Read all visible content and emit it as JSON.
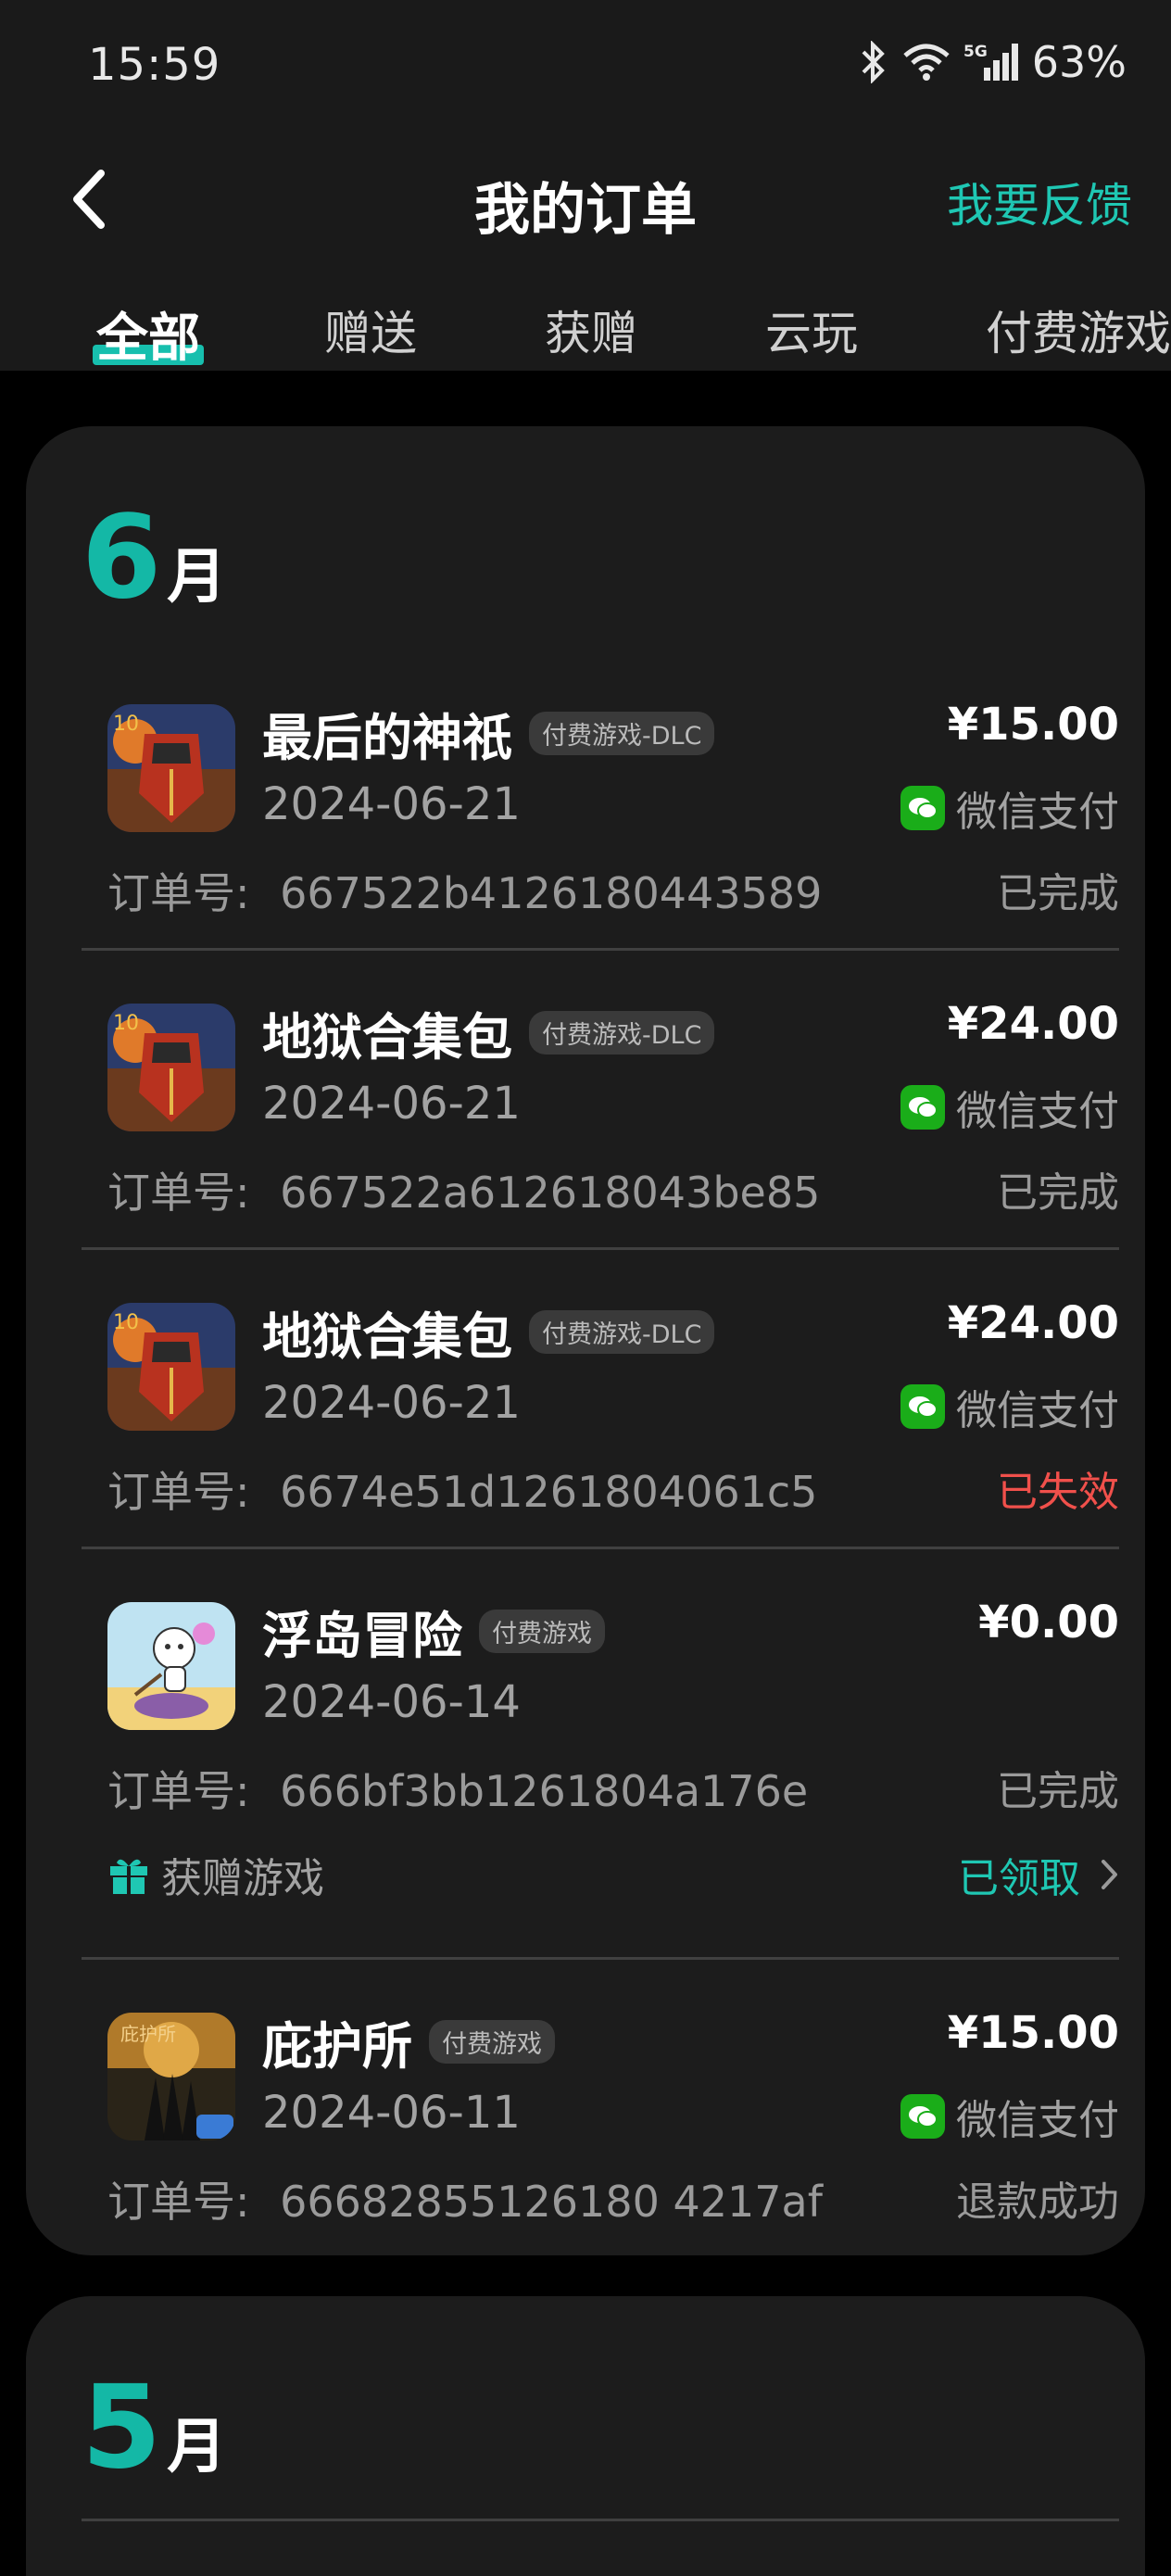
{
  "status_bar": {
    "time": "15:59",
    "network": "5G",
    "battery": "63%",
    "icons": [
      "bluetooth-icon",
      "wifi-icon",
      "cellular-signal-icon"
    ]
  },
  "header": {
    "title": "我的订单",
    "feedback": "我要反馈",
    "back_icon": "chevron-left-icon"
  },
  "tabs": [
    {
      "label": "全部",
      "active": true
    },
    {
      "label": "赠送",
      "active": false
    },
    {
      "label": "获赠",
      "active": false
    },
    {
      "label": "云玩",
      "active": false
    },
    {
      "label": "付费游戏",
      "active": false
    }
  ],
  "colors": {
    "accent": "#14b8a6",
    "failed": "#f0504b",
    "wechat": "#1aad19"
  },
  "months": [
    {
      "month_num": "6",
      "month_unit": "月",
      "orders": [
        {
          "name": "最后的神祇",
          "tag": "付费游戏-DLC",
          "date": "2024-06-21",
          "price": "¥15.00",
          "payment": "微信支付",
          "order_label": "订单号:",
          "order_no": "667522b4126180443589",
          "status": "已完成"
        },
        {
          "name": "地狱合集包",
          "tag": "付费游戏-DLC",
          "date": "2024-06-21",
          "price": "¥24.00",
          "payment": "微信支付",
          "order_label": "订单号:",
          "order_no": "667522a612618043be85",
          "status": "已完成"
        },
        {
          "name": "地狱合集包",
          "tag": "付费游戏-DLC",
          "date": "2024-06-21",
          "price": "¥24.00",
          "payment": "微信支付",
          "order_label": "订单号:",
          "order_no": "6674e51d1261804061c5",
          "status": "已失效"
        },
        {
          "name": "浮岛冒险",
          "tag": "付费游戏",
          "date": "2024-06-14",
          "price": "¥0.00",
          "order_label": "订单号:",
          "order_no": "666bf3bb1261804a176e",
          "status": "已完成",
          "gift_label": "获赠游戏",
          "gift_status": "已领取"
        },
        {
          "name": "庇护所",
          "tag": "付费游戏",
          "date": "2024-06-11",
          "price": "¥15.00",
          "payment": "微信支付",
          "order_label": "订单号:",
          "order_no": "66682855126180 4217af",
          "status": "退款成功"
        }
      ]
    },
    {
      "month_num": "5",
      "month_unit": "月"
    }
  ]
}
